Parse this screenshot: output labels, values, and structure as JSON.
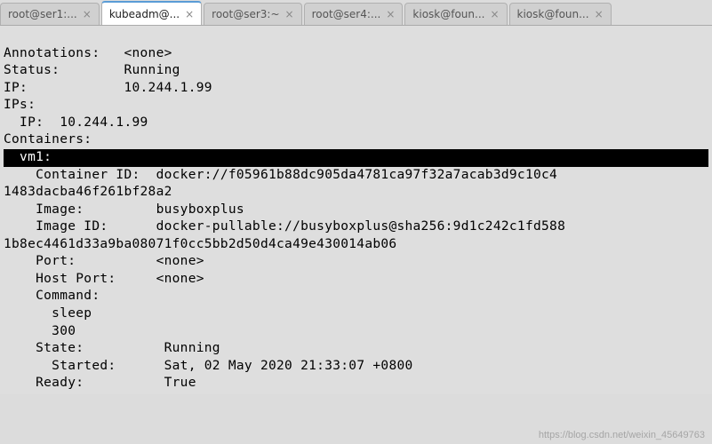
{
  "tabs": [
    {
      "label": "root@ser1:...",
      "active": false
    },
    {
      "label": "kubeadm@...",
      "active": true
    },
    {
      "label": "root@ser3:~",
      "active": false
    },
    {
      "label": "root@ser4:...",
      "active": false
    },
    {
      "label": "kiosk@foun...",
      "active": false
    },
    {
      "label": "kiosk@foun...",
      "active": false
    }
  ],
  "terminal": {
    "field_annotations": "Annotations:",
    "val_annotations": "<none>",
    "field_status": "Status:",
    "val_status": "Running",
    "field_ip": "IP:",
    "val_ip": "10.244.1.99",
    "field_ips": "IPs:",
    "ips_line": "  IP:  10.244.1.99",
    "field_containers": "Containers:",
    "container_header": "  vm1:",
    "field_container_id": "    Container ID:",
    "val_container_id_1": "docker://f05961b88dc905da4781ca97f32a7acab3d9c10c4",
    "val_container_id_2": "1483dacba46f261bf28a2",
    "field_image": "    Image:",
    "val_image": "busyboxplus",
    "field_image_id": "    Image ID:",
    "val_image_id_1": "docker-pullable://busyboxplus@sha256:9d1c242c1fd588",
    "val_image_id_2": "1b8ec4461d33a9ba08071f0cc5bb2d50d4ca49e430014ab06",
    "field_port": "    Port:",
    "val_port": "<none>",
    "field_host_port": "    Host Port:",
    "val_host_port": "<none>",
    "field_command": "    Command:",
    "command_1": "      sleep",
    "command_2": "      300",
    "field_state": "    State:",
    "val_state": "Running",
    "field_started": "      Started:",
    "val_started": "Sat, 02 May 2020 21:33:07 +0800",
    "field_ready": "    Ready:",
    "val_ready": "True"
  },
  "watermark": "https://blog.csdn.net/weixin_45649763"
}
